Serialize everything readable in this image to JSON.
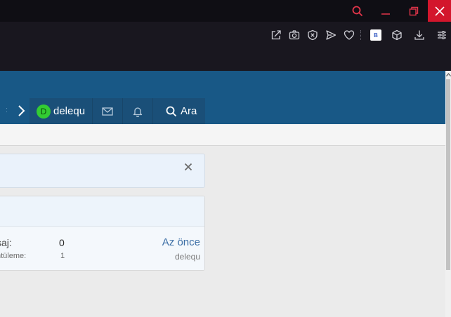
{
  "browser": {
    "titlebar": {
      "buttons": [
        "search",
        "minimize",
        "restore",
        "close"
      ]
    },
    "toolbar": {
      "extension_badge": "B"
    }
  },
  "nav": {
    "username": "delequ",
    "avatar_letter": "D",
    "search_label": "Ara"
  },
  "block": {
    "messages_label": "saj:",
    "messages_value": "0",
    "views_label": "ntüleme:",
    "views_value": "1",
    "last_time": "Az önce",
    "last_user": "delequ"
  },
  "colors": {
    "header_blue": "#185886",
    "nav_group": "#1a4f78",
    "close_red": "#d3162c",
    "avatar_green": "#33cc33",
    "link_blue": "#3b6ea5"
  }
}
